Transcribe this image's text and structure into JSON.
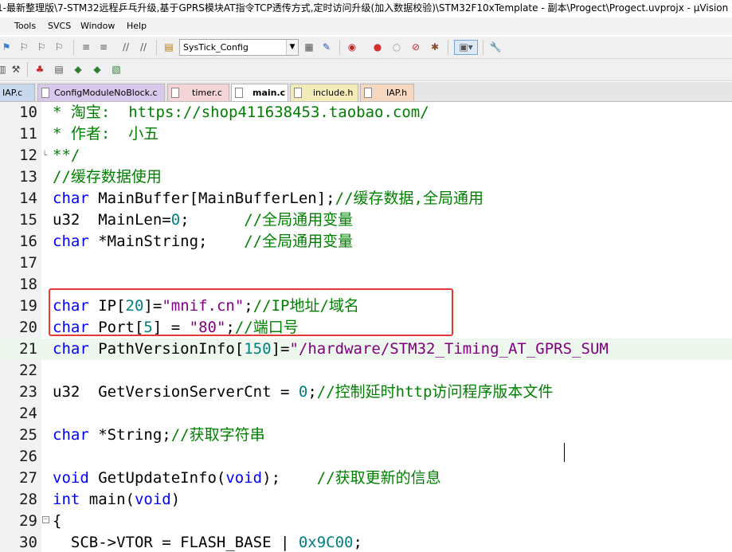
{
  "window": {
    "title": "1-最新整理版\\7-STM32远程乒乓升级,基于GPRS模块AT指令TCP透传方式,定时访问升级(加入数据校验)\\STM32F10xTemplate - 副本\\Progect\\Progect.uvprojx - µVision"
  },
  "menu": [
    "Tools",
    "SVCS",
    "Window",
    "Help"
  ],
  "toolbar": {
    "target_combo": "SysTick_Config"
  },
  "tabs": [
    {
      "label": "IAP.c",
      "color": "#c8d8ec",
      "active": false
    },
    {
      "label": "ConfigModuleNoBlock.c",
      "color": "#d8c8ec",
      "active": false
    },
    {
      "label": "timer.c",
      "color": "#f4d4d4",
      "active": false
    },
    {
      "label": "main.c",
      "color": "#f8f0c8",
      "active": true
    },
    {
      "label": "include.h",
      "color": "#f4ecb8",
      "active": false
    },
    {
      "label": "IAP.h",
      "color": "#f6d8c0",
      "active": false
    }
  ],
  "colors": {
    "keyword": "#0000ff",
    "comment": "#008000",
    "number": "#008080",
    "string": "#800080",
    "highlight_box": "#e53935"
  },
  "code_lines": [
    {
      "num": "10",
      "tokens": [
        [
          "cm",
          "* 淘宝:  https://shop411638453.taobao.com/"
        ]
      ]
    },
    {
      "num": "11",
      "tokens": [
        [
          "cm",
          "* 作者:  小五"
        ]
      ]
    },
    {
      "num": "12",
      "tokens": [
        [
          "cm",
          "**/"
        ]
      ]
    },
    {
      "num": "13",
      "tokens": [
        [
          "cm",
          "//缓存数据使用"
        ]
      ]
    },
    {
      "num": "14",
      "tokens": [
        [
          "kw",
          "char"
        ],
        [
          "tx",
          " MainBuffer[MainBufferLen];"
        ],
        [
          "cm",
          "//缓存数据,全局通用"
        ]
      ]
    },
    {
      "num": "15",
      "tokens": [
        [
          "tx",
          "u32  MainLen="
        ],
        [
          "num",
          "0"
        ],
        [
          "tx",
          ";      "
        ],
        [
          "cm",
          "//全局通用变量"
        ]
      ]
    },
    {
      "num": "16",
      "tokens": [
        [
          "kw",
          "char"
        ],
        [
          "tx",
          " *MainString;    "
        ],
        [
          "cm",
          "//全局通用变量"
        ]
      ]
    },
    {
      "num": "17",
      "tokens": []
    },
    {
      "num": "18",
      "tokens": []
    },
    {
      "num": "19",
      "tokens": [
        [
          "kw",
          "char"
        ],
        [
          "tx",
          " IP["
        ],
        [
          "num",
          "20"
        ],
        [
          "tx",
          "]="
        ],
        [
          "str",
          "\"mnif.cn\""
        ],
        [
          "tx",
          ";"
        ],
        [
          "cm",
          "//IP地址/域名"
        ]
      ]
    },
    {
      "num": "20",
      "tokens": [
        [
          "kw",
          "char"
        ],
        [
          "tx",
          " Port["
        ],
        [
          "num",
          "5"
        ],
        [
          "tx",
          "] = "
        ],
        [
          "str",
          "\"80\""
        ],
        [
          "tx",
          ";"
        ],
        [
          "cm",
          "//端口号"
        ]
      ]
    },
    {
      "num": "21",
      "tokens": [
        [
          "kw",
          "char"
        ],
        [
          "tx",
          " PathVersionInfo["
        ],
        [
          "num",
          "150"
        ],
        [
          "tx",
          "]="
        ],
        [
          "str",
          "\"/hardware/STM32_Timing_AT_GPRS_SUM"
        ]
      ],
      "highlight": true
    },
    {
      "num": "22",
      "tokens": []
    },
    {
      "num": "23",
      "tokens": [
        [
          "tx",
          "u32  GetVersionServerCnt = "
        ],
        [
          "num",
          "0"
        ],
        [
          "tx",
          ";"
        ],
        [
          "cm",
          "//控制延时http访问程序版本文件"
        ]
      ]
    },
    {
      "num": "24",
      "tokens": []
    },
    {
      "num": "25",
      "tokens": [
        [
          "kw",
          "char"
        ],
        [
          "tx",
          " *String;"
        ],
        [
          "cm",
          "//获取字符串"
        ]
      ]
    },
    {
      "num": "26",
      "tokens": []
    },
    {
      "num": "27",
      "tokens": [
        [
          "kw",
          "void"
        ],
        [
          "tx",
          " GetUpdateInfo("
        ],
        [
          "kw",
          "void"
        ],
        [
          "tx",
          ");    "
        ],
        [
          "cm",
          "//获取更新的信息"
        ]
      ]
    },
    {
      "num": "28",
      "tokens": [
        [
          "kw",
          "int"
        ],
        [
          "tx",
          " main("
        ],
        [
          "kw",
          "void"
        ],
        [
          "tx",
          ")"
        ]
      ]
    },
    {
      "num": "29",
      "tokens": [
        [
          "tx",
          "{"
        ]
      ]
    },
    {
      "num": "30",
      "tokens": [
        [
          "tx",
          "  SCB->VTOR = FLASH_BASE | "
        ],
        [
          "num",
          "0x9C00"
        ],
        [
          "tx",
          ";"
        ]
      ]
    }
  ]
}
